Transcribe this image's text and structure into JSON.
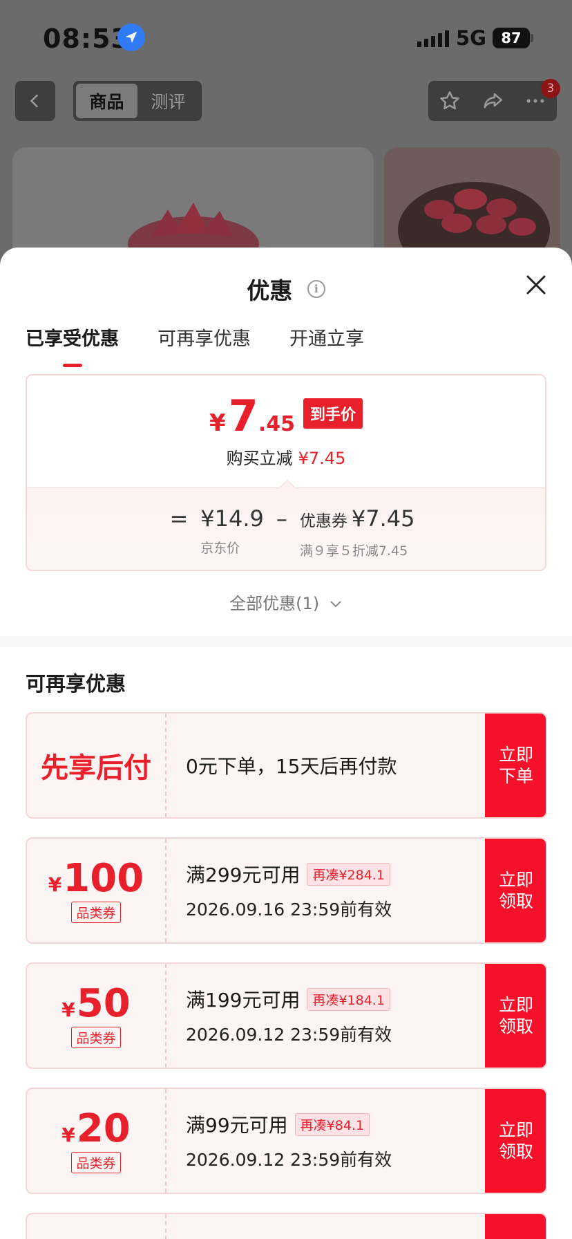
{
  "status_bar": {
    "time": "08:53",
    "network": "5G",
    "battery": "87"
  },
  "top_nav": {
    "tabs": [
      "商品",
      "测评"
    ],
    "active_tab": "商品",
    "notification_count": "3"
  },
  "sheet": {
    "title": "优惠",
    "info_icon": "info-icon",
    "tabs": [
      "已享受优惠",
      "可再享优惠",
      "开通立享"
    ],
    "active_tab": "已享受优惠"
  },
  "price_summary": {
    "currency": "¥",
    "price_int": "7",
    "price_dec": ".45",
    "price_tag": "到手价",
    "save_label": "购买立减",
    "save_amount": "¥7.45",
    "eq": "=",
    "minus": "–",
    "jd_price": "¥14.9",
    "jd_label": "京东价",
    "coupon_label": "优惠券",
    "coupon_value": "¥7.45",
    "coupon_desc": "满９享５折减7.45"
  },
  "all_discounts": "全部优惠(1)",
  "more_section": {
    "title": "可再享优惠",
    "pay_later": {
      "name": "先享后付",
      "desc": "0元下单，15天后再付款",
      "button": "立即下单"
    },
    "coupons": [
      {
        "currency": "¥",
        "amount": "100",
        "type": "品类券",
        "condition": "满299元可用",
        "chip": "再凑¥284.1",
        "expiry": "2026.09.16 23:59前有效",
        "button": "立即领取"
      },
      {
        "currency": "¥",
        "amount": "50",
        "type": "品类券",
        "condition": "满199元可用",
        "chip": "再凑¥184.1",
        "expiry": "2026.09.12 23:59前有效",
        "button": "立即领取"
      },
      {
        "currency": "¥",
        "amount": "20",
        "type": "品类券",
        "condition": "满99元可用",
        "chip": "再凑¥84.1",
        "expiry": "2026.09.12 23:59前有效",
        "button": "立即领取"
      }
    ]
  }
}
